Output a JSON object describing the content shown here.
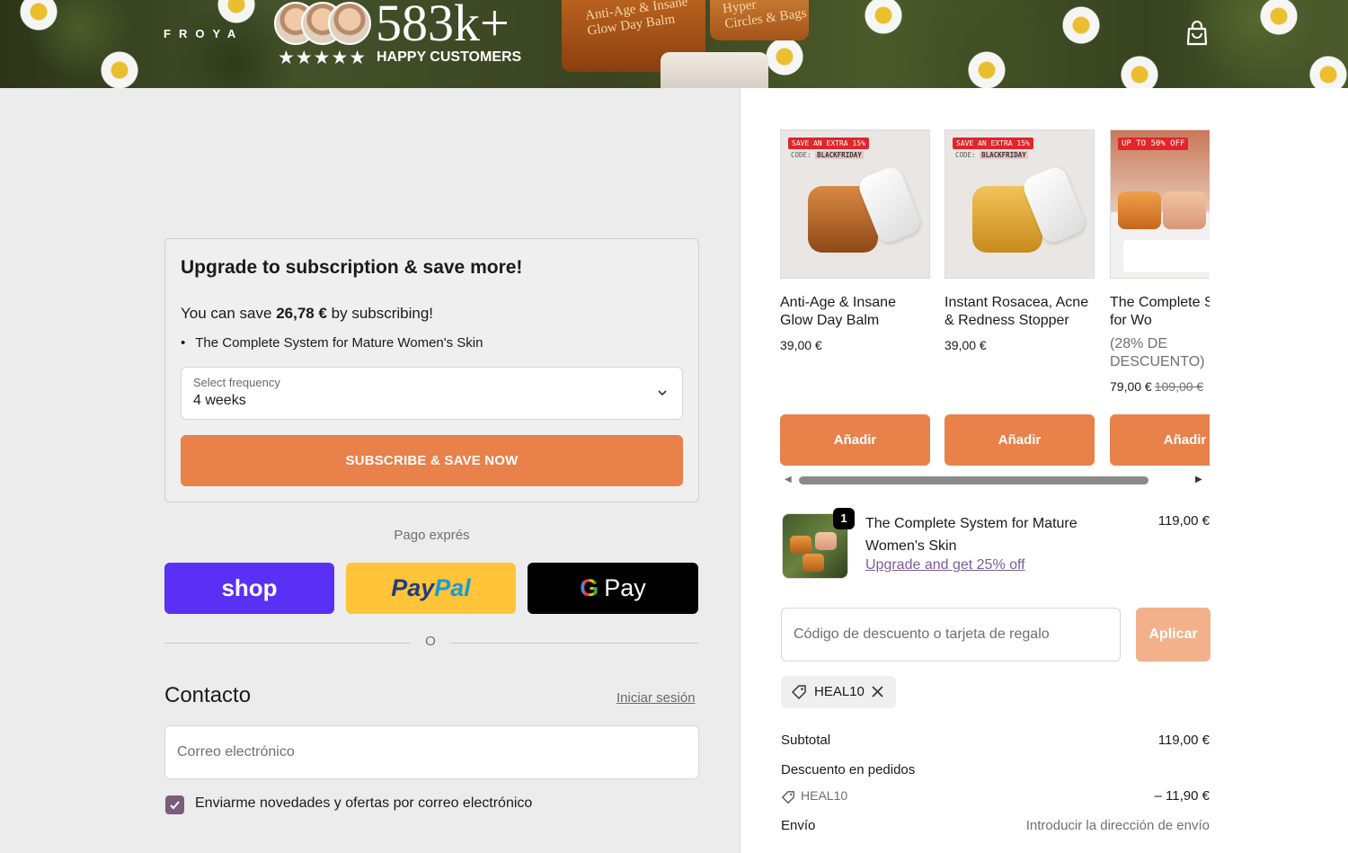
{
  "header": {
    "brand": "FROYA",
    "customer_count": "583k+",
    "stars": "★★★★★",
    "tagline": "HAPPY CUSTOMERS",
    "hero_jar_1": "Anti-Age & Insane\nGlow Day Balm",
    "hero_jar_2": "Hyper\nCircles & Bags",
    "cart_icon": "shopping-bag-icon"
  },
  "upsell": {
    "title": "Upgrade to subscription & save more!",
    "save_prefix": "You can save ",
    "save_amount": "26,78 €",
    "save_suffix": " by subscribing!",
    "item": "The Complete System for Mature Women's Skin",
    "frequency_label": "Select frequency",
    "frequency_value": "4 weeks",
    "cta": "SUBSCRIBE & SAVE NOW"
  },
  "express": {
    "label": "Pago exprés",
    "shop": "shop",
    "paypal_a": "Pay",
    "paypal_b": "Pal",
    "gpay_g": "G",
    "gpay": "Pay",
    "or": "O"
  },
  "contact": {
    "title": "Contacto",
    "login": "Iniciar sesión",
    "email_placeholder": "Correo electrónico",
    "newsletter": "Enviarme novedades y ofertas por correo electrónico",
    "newsletter_checked": true
  },
  "products": [
    {
      "promo": "SAVE AN EXTRA 15%",
      "code_label": "CODE:",
      "code": "BLACKFRIDAY",
      "name": "Anti-Age & Insane Glow Day Balm",
      "price": "39,00 €",
      "add": "Añadir",
      "jar_color": "#b5652a"
    },
    {
      "promo": "SAVE AN EXTRA 15%",
      "code_label": "CODE:",
      "code": "BLACKFRIDAY",
      "name": "Instant Rosacea, Acne & Redness Stopper",
      "price": "39,00 €",
      "add": "Añadir",
      "jar_color": "#d99a2a"
    },
    {
      "promo": "UP TO 50% OFF",
      "name": "The Complete System for Wo",
      "discount": "(28% DE DESCUENTO)",
      "price": "79,00 €",
      "compare_price": "109,00 €",
      "add": "Añadir",
      "jar_color": "#e07a2e"
    }
  ],
  "cart_line": {
    "quantity": "1",
    "name": "The Complete System for Mature Women's Skin",
    "upgrade": "Upgrade and get 25% off",
    "price": "119,00 €"
  },
  "discount": {
    "placeholder": "Código de descuento o tarjeta de regalo",
    "apply": "Aplicar",
    "applied_code": "HEAL10"
  },
  "summary": {
    "subtotal_label": "Subtotal",
    "subtotal_value": "119,00 €",
    "discount_label": "Descuento en pedidos",
    "discount_code": "HEAL10",
    "discount_value": "– 11,90 €",
    "shipping_label": "Envío",
    "shipping_value": "Introducir la dirección de envío"
  },
  "colors": {
    "accent_orange": "#e8814a",
    "apply_disabled": "#f2b18a",
    "shop_purple": "#5a31f4",
    "paypal_yellow": "#ffc439",
    "checkbox_purple": "#7b5d7b",
    "link_purple": "#7b5d9b"
  }
}
